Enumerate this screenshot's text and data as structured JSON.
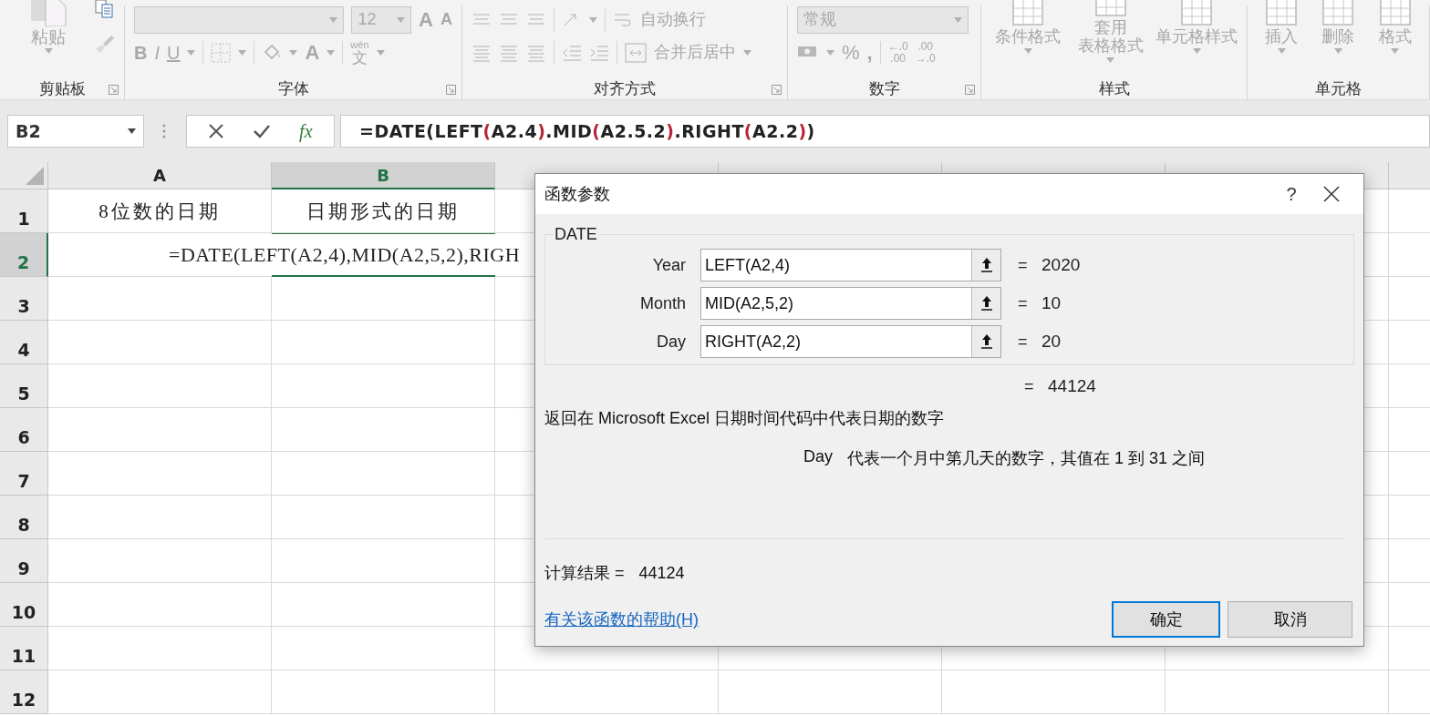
{
  "ribbon": {
    "disabled": true,
    "groups": [
      {
        "kind": "clipboard",
        "label": "剪贴板",
        "launcher": true,
        "paste": "粘贴"
      },
      {
        "kind": "font",
        "label": "字体",
        "launcher": true,
        "size": "12",
        "grow": "A",
        "shrink": "A",
        "bold": "B",
        "italic": "I",
        "underline": "U",
        "font_color": "A",
        "phonetic": "wén",
        "phonetic_char": "文"
      },
      {
        "kind": "alignment",
        "label": "对齐方式",
        "launcher": true,
        "wrap": "自动换行",
        "merge": "合并后居中"
      },
      {
        "kind": "number",
        "label": "数字",
        "launcher": true,
        "format": "常规",
        "percent": "%",
        "comma": ",",
        "decimals": [
          {
            "top": "←.0",
            "bottom": ".00"
          },
          {
            "top": ".00",
            "bottom": "→.0"
          }
        ]
      },
      {
        "kind": "buttons",
        "label": "样式",
        "launcher": false,
        "items": [
          {
            "lines": [
              "条件格式"
            ]
          },
          {
            "lines": [
              "套用",
              "表格格式"
            ]
          },
          {
            "lines": [
              "单元格样式"
            ]
          }
        ]
      },
      {
        "kind": "buttons",
        "label": "单元格",
        "launcher": false,
        "items": [
          {
            "lines": [
              "插入"
            ]
          },
          {
            "lines": [
              "删除"
            ]
          },
          {
            "lines": [
              "格式"
            ]
          }
        ]
      }
    ]
  },
  "name_box": "B2",
  "formula_bar": {
    "fx": "fx",
    "segments": [
      {
        "text": "=DATE(LEFT",
        "kind": "plain"
      },
      {
        "text": "(",
        "kind": "paren"
      },
      {
        "text": "A2.4",
        "kind": "plain"
      },
      {
        "text": ")",
        "kind": "paren"
      },
      {
        "text": ".MID",
        "kind": "plain"
      },
      {
        "text": "(",
        "kind": "paren"
      },
      {
        "text": "A2.5.2",
        "kind": "plain"
      },
      {
        "text": ")",
        "kind": "paren"
      },
      {
        "text": ".RIGHT",
        "kind": "plain"
      },
      {
        "text": "(",
        "kind": "paren"
      },
      {
        "text": "A2.2",
        "kind": "plain"
      },
      {
        "text": ")",
        "kind": "paren"
      },
      {
        "text": ")",
        "kind": "plain"
      }
    ]
  },
  "sheet": {
    "columns": [
      {
        "label": "A",
        "selected": false
      },
      {
        "label": "B",
        "selected": true
      }
    ],
    "rows": [
      {
        "label": "1",
        "selected": false,
        "cells": [
          "8位数的日期",
          "日期形式的日期"
        ]
      },
      {
        "label": "2",
        "selected": true,
        "editing": "=DATE(LEFT(A2,4),MID(A2,5,2),RIGH"
      },
      {
        "label": "3",
        "selected": false
      },
      {
        "label": "4",
        "selected": false
      },
      {
        "label": "5",
        "selected": false
      },
      {
        "label": "6",
        "selected": false
      },
      {
        "label": "7",
        "selected": false
      },
      {
        "label": "8",
        "selected": false
      },
      {
        "label": "9",
        "selected": false
      },
      {
        "label": "10",
        "selected": false
      },
      {
        "label": "11",
        "selected": false
      },
      {
        "label": "12",
        "selected": false
      }
    ]
  },
  "dialog": {
    "title": "函数参数",
    "help": "?",
    "function_name": "DATE",
    "args": [
      {
        "label": "Year",
        "value": "LEFT(A2,4)",
        "eq": "=",
        "result": "2020"
      },
      {
        "label": "Month",
        "value": "MID(A2,5,2)",
        "eq": "=",
        "result": "10"
      },
      {
        "label": "Day",
        "value": "RIGHT(A2,2)",
        "eq": "=",
        "result": "20"
      }
    ],
    "total_eq": "=",
    "total": "44124",
    "description": "返回在 Microsoft Excel 日期时间代码中代表日期的数字",
    "arg_help": {
      "name": "Day",
      "text": "代表一个月中第几天的数字，其值在 1 到 31 之间"
    },
    "calc_label": "计算结果 =",
    "calc_value": "44124",
    "help_link": "有关该函数的帮助(H)",
    "buttons": [
      {
        "label": "确定",
        "focused": true
      },
      {
        "label": "取消",
        "focused": false
      }
    ]
  }
}
